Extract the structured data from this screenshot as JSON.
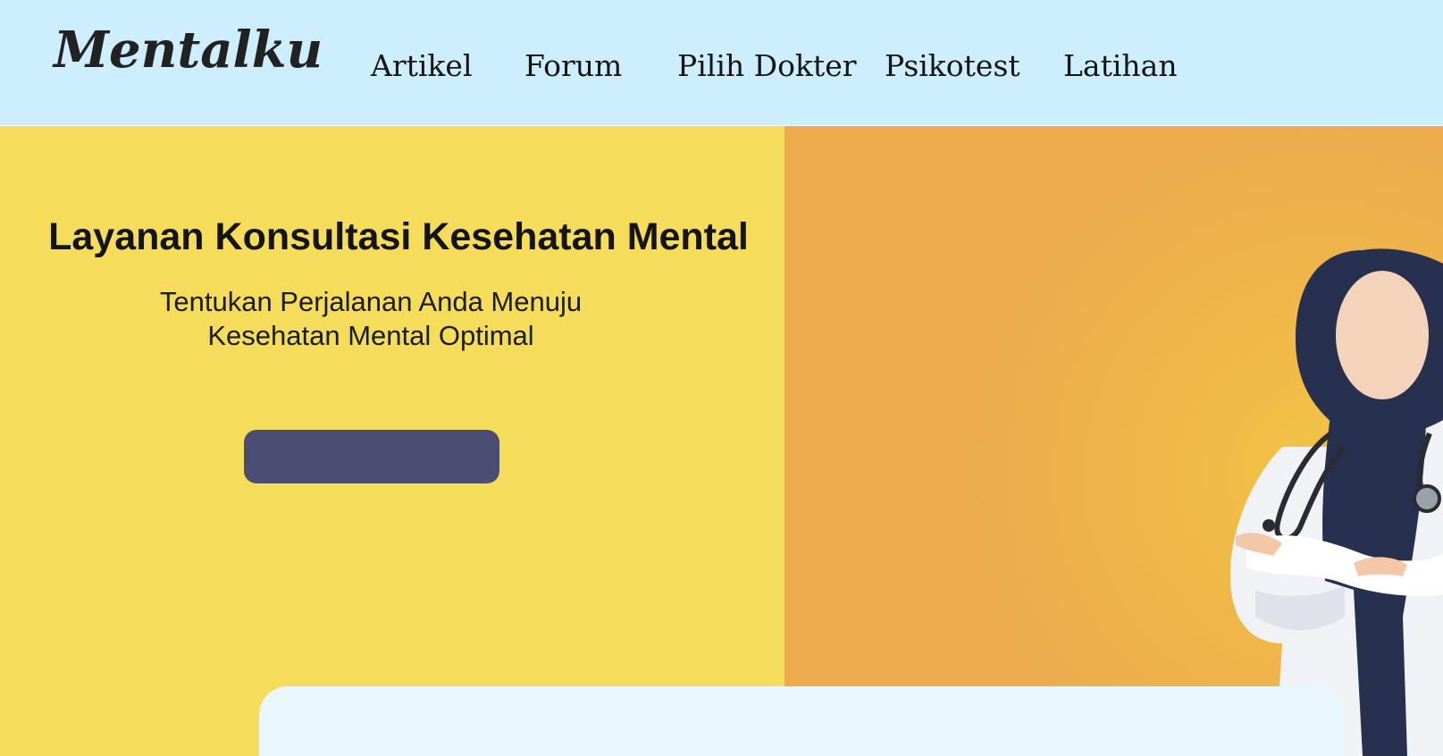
{
  "header": {
    "logo": "Mentalku",
    "nav": [
      "Artikel",
      "Forum",
      "Pilih Dokter",
      "Psikotest",
      "Latihan"
    ]
  },
  "hero": {
    "title": "Layanan Konsultasi Kesehatan Mental",
    "subtitle_line1": "Tentukan Perjalanan Anda Menuju",
    "subtitle_line2": "Kesehatan Mental Optimal",
    "button_label": ""
  },
  "colors": {
    "header_bg": "#cdeefc",
    "hero_left_bg": "#f5dc5b",
    "hero_right_bg": "#ecac4d",
    "button_bg": "#4b4d72",
    "card_bg": "#e9f7fd"
  },
  "icons": {
    "logo": "mentalku-wordmark",
    "illustration": "doctor-illustration"
  }
}
